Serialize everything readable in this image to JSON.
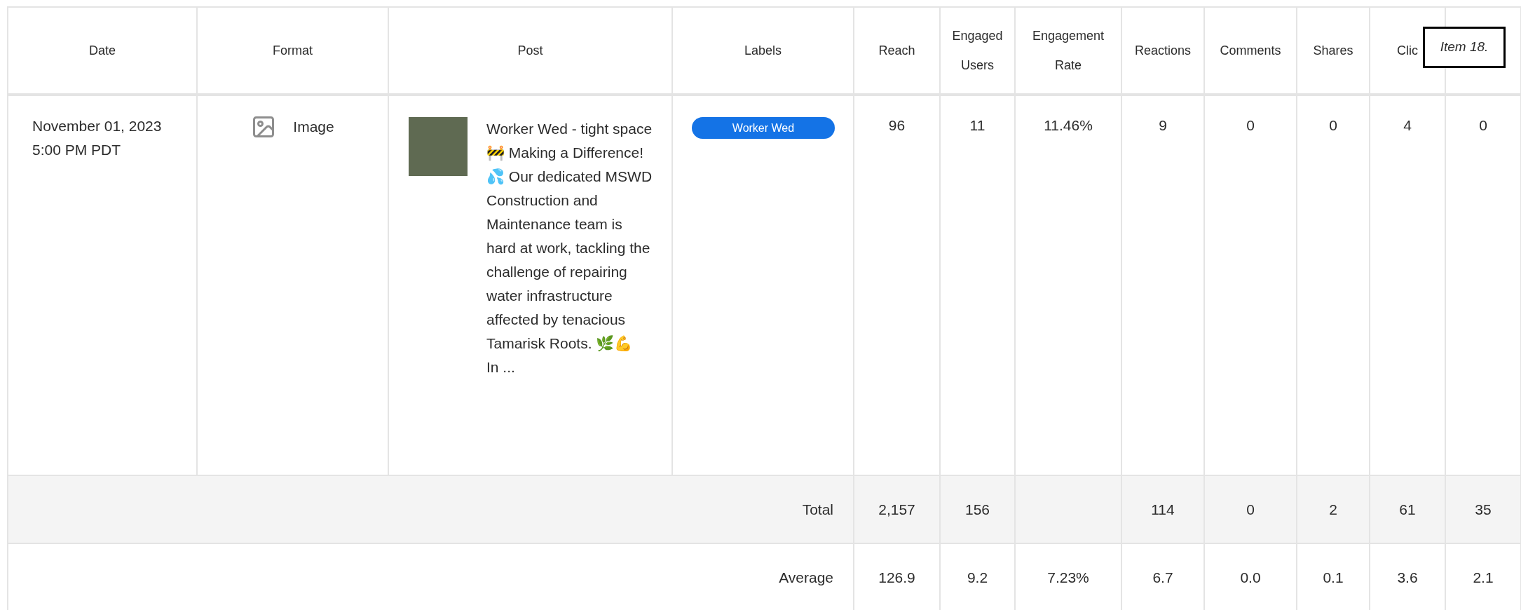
{
  "columns": [
    "Date",
    "Format",
    "Post",
    "Labels",
    "Reach",
    "Engaged\nUsers",
    "Engagement\nRate",
    "Reactions",
    "Comments",
    "Shares",
    "Clic"
  ],
  "overlay_label": "Item 18.",
  "rows": [
    {
      "date": "November 01, 2023\n5:00 PM PDT",
      "format": {
        "kind": "image",
        "label": "Image"
      },
      "post": "Worker Wed - tight space\n🚧 Making a Difference! 💦 Our dedicated MSWD Construction and Maintenance team is hard at work, tackling the challenge of repairing water infrastructure affected by tenacious Tamarisk Roots. 🌿💪\nIn ...",
      "labels": [
        {
          "text": "Worker Wed",
          "color": "#1473e6"
        }
      ],
      "metrics": [
        "96",
        "11",
        "11.46%",
        "9",
        "0",
        "0",
        "4",
        "0"
      ]
    }
  ],
  "summary": [
    {
      "label": "Total",
      "kind": "total",
      "metrics": {
        "reach": "2,157",
        "engaged_users": "156",
        "reactions": "114",
        "comments": "0",
        "shares": "2",
        "column_11": "61",
        "column_12": "35"
      }
    },
    {
      "label": "Average",
      "kind": "average",
      "metrics": {
        "reach": "126.9",
        "engaged_users": "9.2",
        "engagement_rate": "7.23%",
        "reactions": "6.7",
        "comments": "0.0",
        "shares": "0.1",
        "column_11": "3.6",
        "column_12": "2.1"
      }
    }
  ]
}
